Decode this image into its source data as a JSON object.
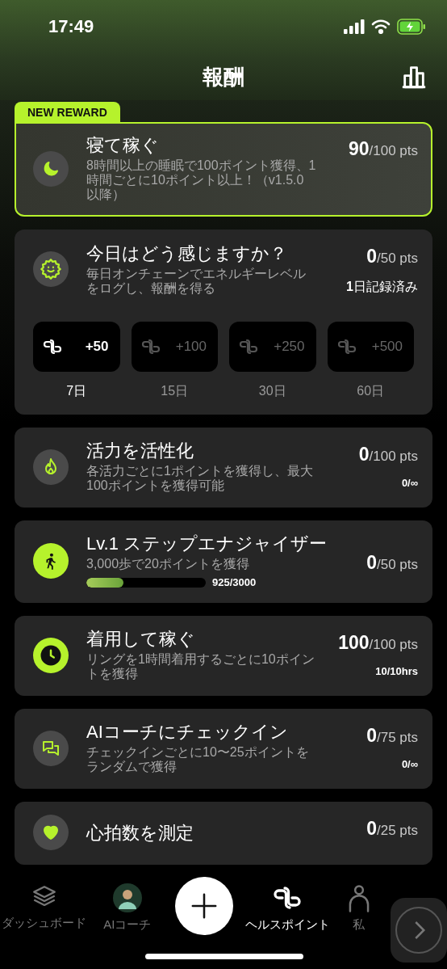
{
  "status_bar": {
    "time": "17:49"
  },
  "header": {
    "title": "報酬"
  },
  "rewards": [
    {
      "kind": "plain",
      "badge": "NEW REWARD",
      "icon_filled": false,
      "title": "寝て稼ぐ",
      "description": "8時間以上の睡眠で100ポイント獲得、1時間ごとに10ポイント以上！（v1.5.0以降）",
      "points": "90",
      "max": "/100 pts"
    },
    {
      "kind": "streak",
      "icon_filled": false,
      "title": "今日はどう感じますか？",
      "description": "毎日オンチェーンでエネルギーレベルをログし、報酬を得る",
      "points": "0",
      "max": "/50 pts",
      "counter": "**1**日記録済み",
      "milestones": [
        {
          "bonus": "+50",
          "days": "7日",
          "reached": true
        },
        {
          "bonus": "+100",
          "days": "15日",
          "reached": false
        },
        {
          "bonus": "+250",
          "days": "30日",
          "reached": false
        },
        {
          "bonus": "+500",
          "days": "60日",
          "reached": false
        }
      ]
    },
    {
      "kind": "plain",
      "icon_filled": false,
      "title": "活力を活性化",
      "description": "各活力ごとに1ポイントを獲得し、最大100ポイントを獲得可能",
      "points": "0",
      "max": "/100 pts",
      "counter": "0/∞"
    },
    {
      "kind": "progress",
      "icon_filled": true,
      "title": "Lv.1 ステップエナジャイザー",
      "description": "3,000歩で20ポイントを獲得",
      "points": "0",
      "max": "/50 pts",
      "level": 0.31,
      "reading": "925/3000"
    },
    {
      "kind": "plain",
      "icon_filled": true,
      "title": "着用して稼ぐ",
      "description": "リングを1時間着用するごとに10ポイントを獲得",
      "points": "100",
      "max": "/100 pts",
      "counter": "10/10hrs"
    },
    {
      "kind": "plain",
      "icon_filled": false,
      "title": "AIコーチにチェックイン",
      "description": "チェックインごとに10〜25ポイントをランダムで獲得",
      "points": "0",
      "max": "/75 pts",
      "counter": "0/∞"
    },
    {
      "kind": "plain",
      "icon_filled": false,
      "title": "心拍数を測定",
      "points": "0",
      "max": "/25 pts"
    }
  ],
  "tab_bar": [
    {
      "kind": "icon",
      "label": "ダッシュボード",
      "selected": false
    },
    {
      "kind": "avatar",
      "label": "AIコーチ",
      "selected": false
    },
    {
      "kind": "plus"
    },
    {
      "kind": "icon",
      "label": "ヘルスポイント",
      "selected": true
    },
    {
      "kind": "icon",
      "label": "私",
      "selected": false
    }
  ]
}
